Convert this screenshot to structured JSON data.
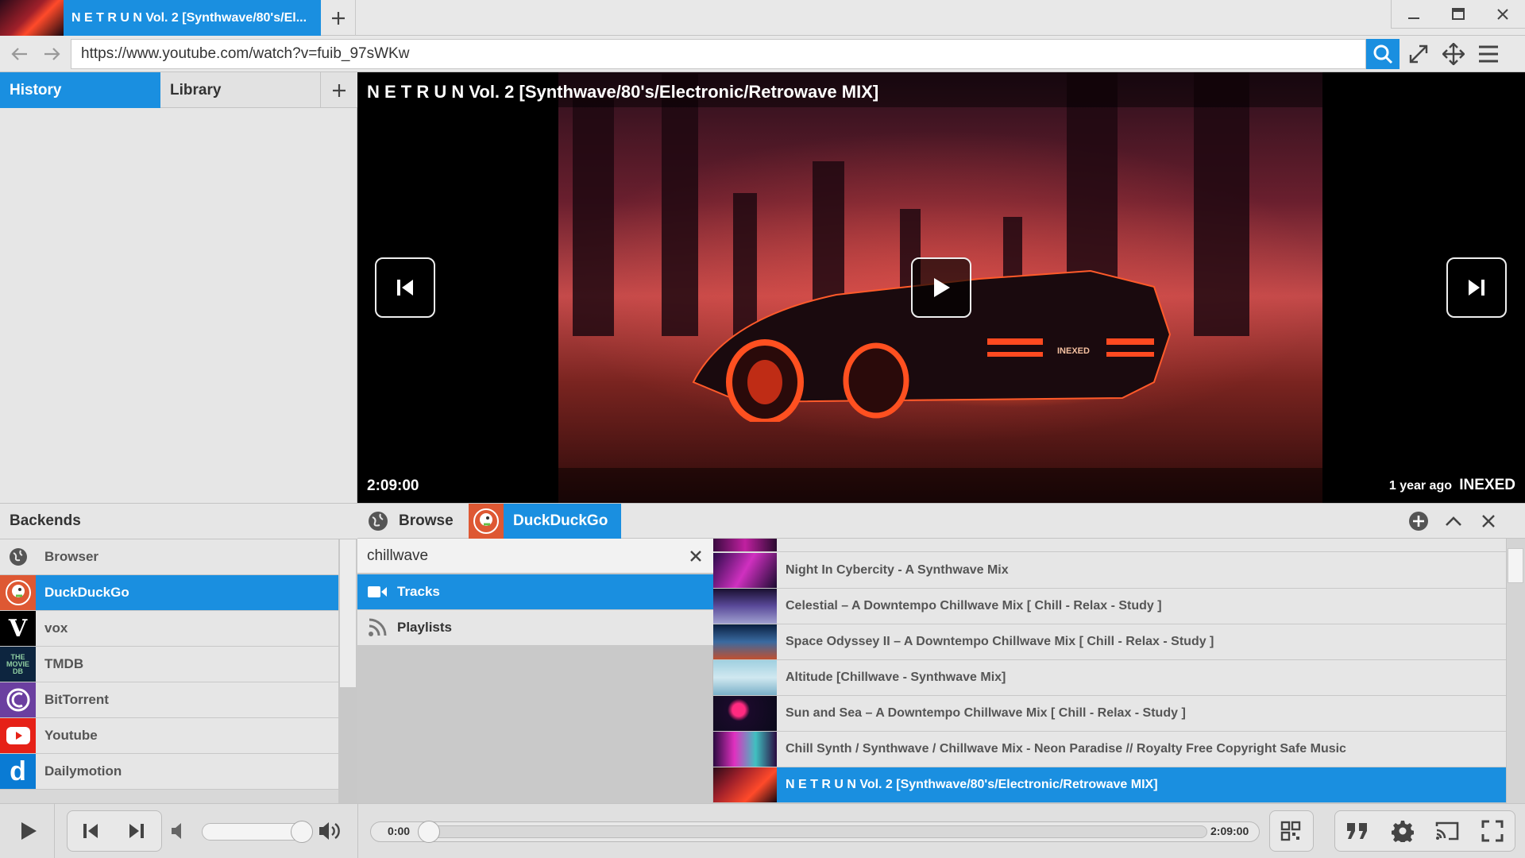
{
  "colors": {
    "accent": "#1a8fe0",
    "panel": "#e6e6e6",
    "border": "#c4c4c4"
  },
  "window": {
    "tab_title": "N E T R U N Vol. 2 [Synthwave/80's/El...",
    "new_tab_icon": "plus-icon",
    "controls": [
      "minimize-icon",
      "maximize-icon",
      "close-icon"
    ]
  },
  "address_bar": {
    "url": "https://www.youtube.com/watch?v=fuib_97sWKw",
    "icons": [
      "back-arrow-icon",
      "forward-arrow-icon",
      "search-icon",
      "expand-icon",
      "move-icon",
      "menu-icon"
    ]
  },
  "left_panel": {
    "tabs": [
      {
        "label": "History"
      },
      {
        "label": "Library"
      }
    ],
    "add_icon": "plus-icon"
  },
  "video": {
    "title": "N E T R U N Vol. 2 [Synthwave/80's/Electronic/Retrowave MIX]",
    "duration": "2:09:00",
    "age": "1 year ago",
    "channel": "INEXED",
    "plate": "INEXED",
    "overlay_icons": [
      "skip-previous-icon",
      "play-icon",
      "skip-next-icon"
    ]
  },
  "backends": {
    "header": "Backends",
    "items": [
      {
        "label": "Browser",
        "icon": "globe-icon",
        "active": false
      },
      {
        "label": "DuckDuckGo",
        "icon": "duckduckgo-icon",
        "active": true
      },
      {
        "label": "vox",
        "icon": "vox-icon",
        "active": false
      },
      {
        "label": "TMDB",
        "icon": "tmdb-icon",
        "active": false
      },
      {
        "label": "BitTorrent",
        "icon": "bittorrent-icon",
        "active": false
      },
      {
        "label": "Youtube",
        "icon": "youtube-icon",
        "active": false
      },
      {
        "label": "Dailymotion",
        "icon": "dailymotion-icon",
        "active": false
      }
    ]
  },
  "browse": {
    "browse_label": "Browse",
    "source_label": "DuckDuckGo",
    "query": "chillwave",
    "filters": [
      {
        "label": "Tracks",
        "icon": "video-camera-icon",
        "active": true
      },
      {
        "label": "Playlists",
        "icon": "rss-feed-icon",
        "active": false
      }
    ],
    "results": [
      {
        "title": "Night In Cybercity - A Synthwave Mix",
        "active": false
      },
      {
        "title": "Celestial – A Downtempo Chillwave Mix [ Chill - Relax - Study ]",
        "active": false
      },
      {
        "title": "Space Odyssey II – A Downtempo Chillwave Mix [ Chill - Relax - Study ]",
        "active": false
      },
      {
        "title": "Altitude [Chillwave - Synthwave Mix]",
        "active": false
      },
      {
        "title": "Sun and Sea – A Downtempo Chillwave Mix [ Chill - Relax - Study ]",
        "active": false
      },
      {
        "title": "Chill Synth / Synthwave / Chillwave Mix - Neon Paradise // Royalty Free Copyright Safe Music",
        "active": false
      },
      {
        "title": "N E T R U N Vol. 2 [Synthwave/80's/Electronic/Retrowave MIX]",
        "active": true
      }
    ]
  },
  "player": {
    "current_time": "0:00",
    "total_time": "2:09:00",
    "progress_fraction": 0.0,
    "volume_fraction": 0.92
  }
}
